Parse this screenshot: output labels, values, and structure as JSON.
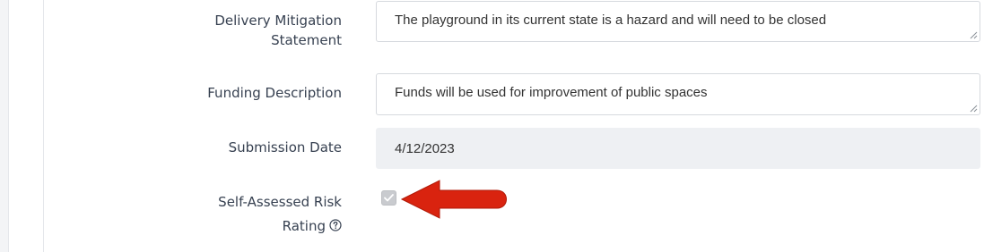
{
  "form": {
    "mitigation": {
      "label_line1": "Delivery Mitigation",
      "label_line2": "Statement",
      "value": "The playground in its current state is a hazard and will need to be closed"
    },
    "funding": {
      "label": "Funding Description",
      "value": "Funds will be used for improvement of public spaces"
    },
    "submission_date": {
      "label": "Submission Date",
      "value": "4/12/2023"
    },
    "risk_rating": {
      "label_line1": "Self-Assessed Risk",
      "label_line2": "Rating",
      "checked": true
    }
  },
  "annotation": {
    "arrow_color": "#d9230f",
    "icon": "left-arrow-icon"
  },
  "colors": {
    "input_border": "#d6d9de",
    "readonly_bg": "#eef0f3",
    "label_text": "#374151"
  }
}
